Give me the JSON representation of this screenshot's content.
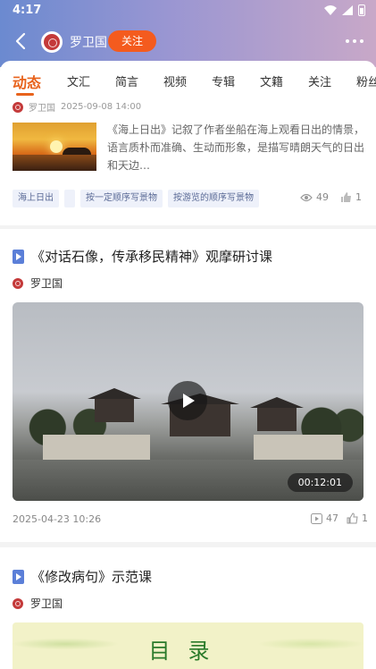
{
  "status_bar": {
    "time": "4:17"
  },
  "header": {
    "back_icon": "chevron-left-icon",
    "account_name": "罗卫国",
    "follow_label": "关注",
    "more_icon": "more-horizontal-icon"
  },
  "tabs": [
    {
      "label": "动态",
      "active": true
    },
    {
      "label": "文汇"
    },
    {
      "label": "简言"
    },
    {
      "label": "视频"
    },
    {
      "label": "专辑"
    },
    {
      "label": "文籍"
    },
    {
      "label": "关注"
    },
    {
      "label": "粉丝"
    }
  ],
  "feed": [
    {
      "author": "罗卫国",
      "date": "2025-09-08 14:00",
      "description": "《海上日出》记叙了作者坐船在海上观看日出的情景，语言质朴而准确、生动而形象，是描写晴朗天气的日出和天边…",
      "tags": [
        "海上日出",
        "",
        "按一定顺序写景物",
        "按游览的顺序写景物"
      ],
      "views": "49",
      "likes": "1"
    },
    {
      "title": "《对话石像，传承移民精神》观摩研讨课",
      "author": "罗卫国",
      "duration": "00:12:01",
      "date": "2025-04-23 10:26",
      "plays": "47",
      "likes": "1"
    },
    {
      "title": "《修改病句》示范课",
      "author": "罗卫国",
      "cover_text": "目录"
    }
  ],
  "colors": {
    "accent": "#e8631c",
    "follow_button": "#f45b1e",
    "doc_icon": "#5b7fd8"
  }
}
